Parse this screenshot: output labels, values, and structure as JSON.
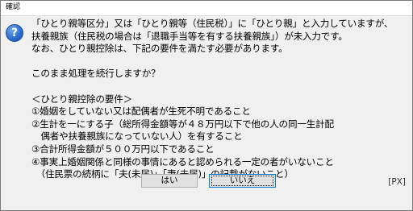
{
  "window": {
    "title": "確認"
  },
  "message": {
    "lines": [
      "「ひとり親等区分」又は「ひとり親等（住民税）」に「ひとり親」と入力していますが、",
      "扶養親族（住民税の場合は「退職手当等を有する扶養親族」）が未入力です。",
      "なお、ひとり親控除は、下記の要件を満たす必要があります。",
      "",
      "このまま処理を続行しますか？",
      "",
      "＜ひとり親控除の要件＞",
      "①婚姻をしていない又は配偶者が生死不明であること",
      "②生計を一にする子（総所得金額等が４８万円以下で他の人の同一生計配",
      "　偶者や扶養親族になっていない人）を有すること",
      "③合計所得金額が５００万円以下であること",
      "④事実上婚姻関係と同様の事情にあると認められる一定の者がいないこと",
      "　（住民票の続柄に「夫(未届)」「妻(未届)」の記載がないこと）"
    ]
  },
  "buttons": {
    "yes_label": "はい",
    "no_label": "いいえ"
  },
  "code_label": "[PX]",
  "icon": {
    "name": "question-icon",
    "glyph": "?",
    "color": "#2f6fd0"
  }
}
